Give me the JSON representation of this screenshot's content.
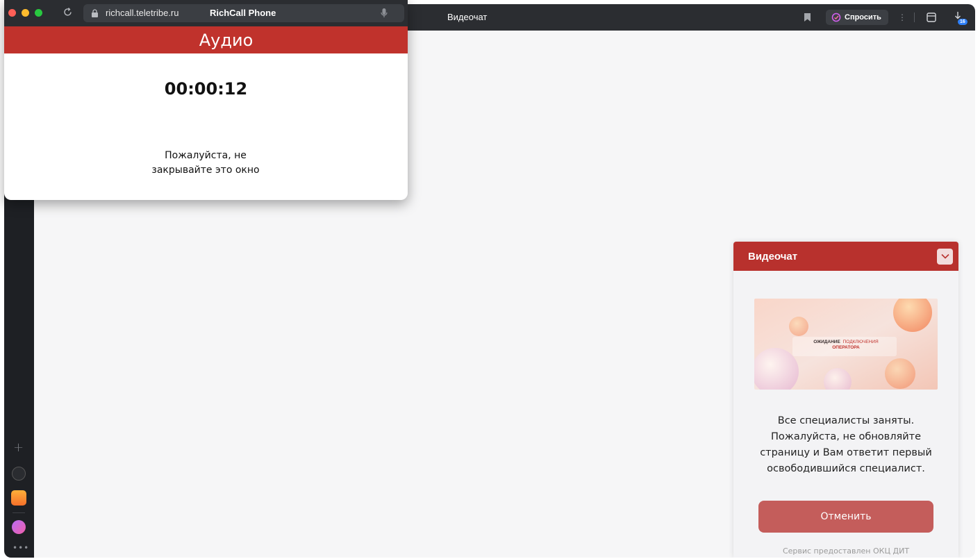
{
  "main_window": {
    "tab_title": "Видеочат",
    "ask_button_label": "Спросить",
    "downloads_badge": "16"
  },
  "popup": {
    "url_domain": "richcall.teletribe.ru",
    "page_title": "RichCall Phone",
    "header": "Аудио",
    "timer": "00:00:12",
    "message_line1": "Пожалуйста, не",
    "message_line2": "закрывайте это окно"
  },
  "widget": {
    "title": "Видеочат",
    "banner_text_bold": "ОЖИДАНИЕ",
    "banner_text_rest": "ПОДКЛЮЧЕНИЯ",
    "banner_text_line2": "ОПЕРАТОРА",
    "message_line1": "Все специалисты заняты.",
    "message_line2": "Пожалуйста, не обновляйте",
    "message_line3": "страницу и Вам ответит первый",
    "message_line4": "освободившийся специалист.",
    "cancel_label": "Отменить",
    "footer": "Сервис предоставлен ОКЦ ДИТ"
  },
  "colors": {
    "brand_red": "#c0322c",
    "cancel_red": "#c45d5b",
    "browser_dark": "#2b2d31"
  },
  "icons": [
    "reload-icon",
    "lock-icon",
    "mic-icon",
    "bookmark-icon",
    "ask-icon",
    "tabs-icon",
    "downloads-icon",
    "chevron-down-icon"
  ]
}
